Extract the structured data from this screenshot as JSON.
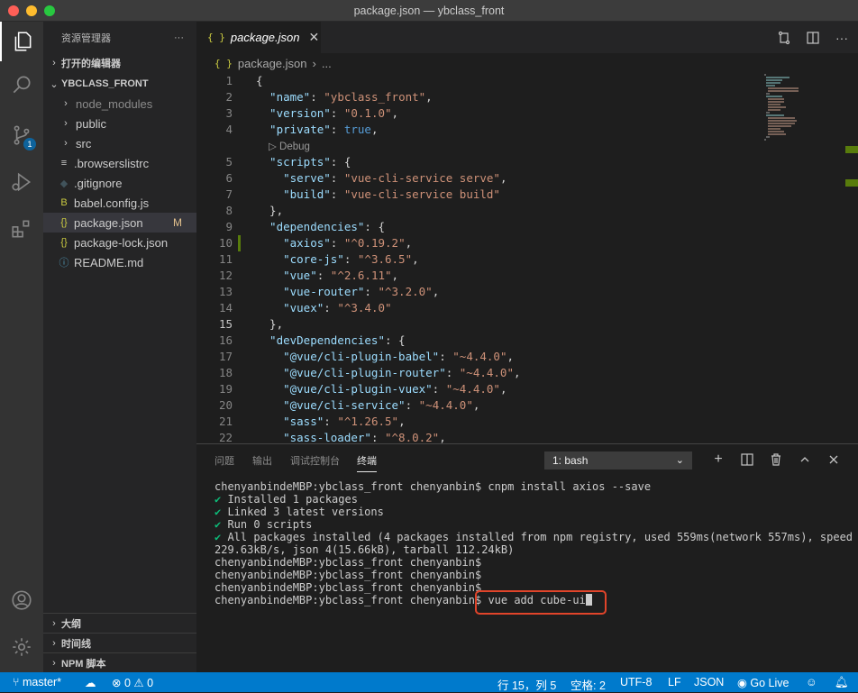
{
  "window": {
    "title": "package.json — ybclass_front"
  },
  "activity": {
    "scm_badge": "1"
  },
  "sidebar": {
    "header": "资源管理器",
    "more": "···",
    "open_editors": "打开的编辑器",
    "project": "YBCLASS_FRONT",
    "items": [
      {
        "label": "node_modules",
        "icon": "chevron-right",
        "type": "folder"
      },
      {
        "label": "public",
        "icon": "chevron-right",
        "type": "folder"
      },
      {
        "label": "src",
        "icon": "chevron-right",
        "type": "folder"
      },
      {
        "label": ".browserslistrc",
        "icon": "lines-icon"
      },
      {
        "label": ".gitignore",
        "icon": "git-icon"
      },
      {
        "label": "babel.config.js",
        "icon": "babel-icon"
      },
      {
        "label": "package.json",
        "icon": "json-icon",
        "badge": "M"
      },
      {
        "label": "package-lock.json",
        "icon": "json-icon"
      },
      {
        "label": "README.md",
        "icon": "info-icon"
      }
    ],
    "outline": "大纲",
    "timeline": "时间线",
    "npm": "NPM 脚本"
  },
  "tab": {
    "icon": "{ }",
    "label": "package.json",
    "close": "✕"
  },
  "breadcrumb": {
    "icon": "{ }",
    "file": "package.json",
    "sep": "›",
    "rest": "..."
  },
  "code": {
    "debug_lens": "▷ Debug",
    "lines": [
      {
        "n": "1",
        "segs": [
          {
            "t": "{",
            "c": "p"
          }
        ]
      },
      {
        "n": "2",
        "segs": [
          {
            "t": "  \"name\"",
            "c": "k"
          },
          {
            "t": ": ",
            "c": "p"
          },
          {
            "t": "\"ybclass_front\"",
            "c": "s"
          },
          {
            "t": ",",
            "c": "p"
          }
        ]
      },
      {
        "n": "3",
        "segs": [
          {
            "t": "  \"version\"",
            "c": "k"
          },
          {
            "t": ": ",
            "c": "p"
          },
          {
            "t": "\"0.1.0\"",
            "c": "s"
          },
          {
            "t": ",",
            "c": "p"
          }
        ]
      },
      {
        "n": "4",
        "segs": [
          {
            "t": "  \"private\"",
            "c": "k"
          },
          {
            "t": ": ",
            "c": "p"
          },
          {
            "t": "true",
            "c": "b"
          },
          {
            "t": ",",
            "c": "p"
          }
        ]
      },
      {
        "n": "5",
        "segs": [
          {
            "t": "  \"scripts\"",
            "c": "k"
          },
          {
            "t": ": {",
            "c": "p"
          }
        ]
      },
      {
        "n": "6",
        "segs": [
          {
            "t": "    \"serve\"",
            "c": "k"
          },
          {
            "t": ": ",
            "c": "p"
          },
          {
            "t": "\"vue-cli-service serve\"",
            "c": "s"
          },
          {
            "t": ",",
            "c": "p"
          }
        ]
      },
      {
        "n": "7",
        "segs": [
          {
            "t": "    \"build\"",
            "c": "k"
          },
          {
            "t": ": ",
            "c": "p"
          },
          {
            "t": "\"vue-cli-service build\"",
            "c": "s"
          }
        ]
      },
      {
        "n": "8",
        "segs": [
          {
            "t": "  },",
            "c": "p"
          }
        ]
      },
      {
        "n": "9",
        "segs": [
          {
            "t": "  \"dependencies\"",
            "c": "k"
          },
          {
            "t": ": {",
            "c": "p"
          }
        ]
      },
      {
        "n": "10",
        "segs": [
          {
            "t": "    \"axios\"",
            "c": "k"
          },
          {
            "t": ": ",
            "c": "p"
          },
          {
            "t": "\"^0.19.2\"",
            "c": "s"
          },
          {
            "t": ",",
            "c": "p"
          }
        ]
      },
      {
        "n": "11",
        "segs": [
          {
            "t": "    \"core-js\"",
            "c": "k"
          },
          {
            "t": ": ",
            "c": "p"
          },
          {
            "t": "\"^3.6.5\"",
            "c": "s"
          },
          {
            "t": ",",
            "c": "p"
          }
        ]
      },
      {
        "n": "12",
        "segs": [
          {
            "t": "    \"vue\"",
            "c": "k"
          },
          {
            "t": ": ",
            "c": "p"
          },
          {
            "t": "\"^2.6.11\"",
            "c": "s"
          },
          {
            "t": ",",
            "c": "p"
          }
        ]
      },
      {
        "n": "13",
        "segs": [
          {
            "t": "    \"vue-router\"",
            "c": "k"
          },
          {
            "t": ": ",
            "c": "p"
          },
          {
            "t": "\"^3.2.0\"",
            "c": "s"
          },
          {
            "t": ",",
            "c": "p"
          }
        ]
      },
      {
        "n": "14",
        "segs": [
          {
            "t": "    \"vuex\"",
            "c": "k"
          },
          {
            "t": ": ",
            "c": "p"
          },
          {
            "t": "\"^3.4.0\"",
            "c": "s"
          }
        ]
      },
      {
        "n": "15",
        "segs": [
          {
            "t": "  },",
            "c": "p"
          }
        ]
      },
      {
        "n": "16",
        "segs": [
          {
            "t": "  \"devDependencies\"",
            "c": "k"
          },
          {
            "t": ": {",
            "c": "p"
          }
        ]
      },
      {
        "n": "17",
        "segs": [
          {
            "t": "    \"@vue/cli-plugin-babel\"",
            "c": "k"
          },
          {
            "t": ": ",
            "c": "p"
          },
          {
            "t": "\"~4.4.0\"",
            "c": "s"
          },
          {
            "t": ",",
            "c": "p"
          }
        ]
      },
      {
        "n": "18",
        "segs": [
          {
            "t": "    \"@vue/cli-plugin-router\"",
            "c": "k"
          },
          {
            "t": ": ",
            "c": "p"
          },
          {
            "t": "\"~4.4.0\"",
            "c": "s"
          },
          {
            "t": ",",
            "c": "p"
          }
        ]
      },
      {
        "n": "19",
        "segs": [
          {
            "t": "    \"@vue/cli-plugin-vuex\"",
            "c": "k"
          },
          {
            "t": ": ",
            "c": "p"
          },
          {
            "t": "\"~4.4.0\"",
            "c": "s"
          },
          {
            "t": ",",
            "c": "p"
          }
        ]
      },
      {
        "n": "20",
        "segs": [
          {
            "t": "    \"@vue/cli-service\"",
            "c": "k"
          },
          {
            "t": ": ",
            "c": "p"
          },
          {
            "t": "\"~4.4.0\"",
            "c": "s"
          },
          {
            "t": ",",
            "c": "p"
          }
        ]
      },
      {
        "n": "21",
        "segs": [
          {
            "t": "    \"sass\"",
            "c": "k"
          },
          {
            "t": ": ",
            "c": "p"
          },
          {
            "t": "\"^1.26.5\"",
            "c": "s"
          },
          {
            "t": ",",
            "c": "p"
          }
        ]
      },
      {
        "n": "22",
        "segs": [
          {
            "t": "    \"sass-loader\"",
            "c": "k"
          },
          {
            "t": ": ",
            "c": "p"
          },
          {
            "t": "\"^8.0.2\"",
            "c": "s"
          },
          {
            "t": ",",
            "c": "p"
          }
        ]
      }
    ]
  },
  "panel": {
    "tabs": [
      "问题",
      "输出",
      "调试控制台",
      "终端"
    ],
    "terminal_select": "1: bash",
    "terminal": [
      {
        "t": "chenyanbindeMBP:ybclass_front chenyanbin$ cnpm install axios --save"
      },
      {
        "mark": "✔",
        "t": " Installed 1 packages"
      },
      {
        "mark": "✔",
        "t": " Linked 3 latest versions"
      },
      {
        "mark": "✔",
        "t": " Run 0 scripts"
      },
      {
        "mark": "✔",
        "t": " All packages installed (4 packages installed from npm registry, used 559ms(network 557ms), speed"
      },
      {
        "t": "229.63kB/s, json 4(15.66kB), tarball 112.24kB)"
      },
      {
        "t": "chenyanbindeMBP:ybclass_front chenyanbin$"
      },
      {
        "t": "chenyanbindeMBP:ybclass_front chenyanbin$"
      },
      {
        "t": "chenyanbindeMBP:ybclass_front chenyanbin$"
      }
    ],
    "prompt": "chenyanbindeMBP:ybclass_front chenyanbin$ ",
    "command": "vue add cube-ui"
  },
  "status": {
    "branch": "master*",
    "errors": "0",
    "warnings": "0",
    "position": "行 15，列 5",
    "spaces": "空格: 2",
    "encoding": "UTF-8",
    "eol": "LF",
    "language": "JSON",
    "golive": "Go Live"
  }
}
